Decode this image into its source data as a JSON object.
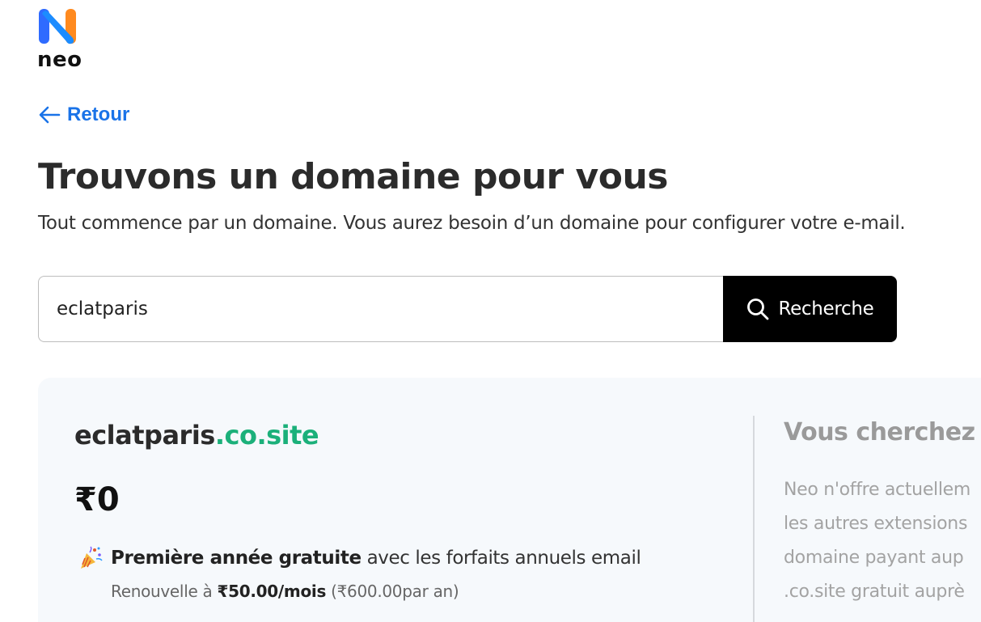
{
  "brand": {
    "name": "neo",
    "colors": {
      "blue": "#2f6bff",
      "orange": "#ff8a1f",
      "accent_link": "#1a73e8",
      "tld_green": "#1bb07a"
    }
  },
  "nav": {
    "back_label": "Retour",
    "back_icon": "arrow-left-icon"
  },
  "header": {
    "title": "Trouvons un domaine pour vous",
    "subtitle": "Tout commence par un domaine. Vous aurez besoin d’un domaine pour configurer votre e-mail."
  },
  "search": {
    "value": "eclatparis",
    "button_label": "Recherche",
    "button_icon": "search-icon"
  },
  "result": {
    "domain_base": "eclatparis",
    "domain_tld": ".co.site",
    "price": "₹0",
    "promo_icon": "party-popper-icon",
    "promo_strong": "Première année gratuite",
    "promo_rest": "avec les forfaits annuels email",
    "renew_prefix": "Renouvelle à",
    "renew_price": "₹50.00/mois",
    "renew_suffix": "(₹600.00par an)"
  },
  "side": {
    "title": "Vous cherchez u",
    "lines": [
      "Neo n'offre actuellem",
      "les autres extensions",
      "domaine payant aup",
      ".co.site gratuit auprè"
    ]
  }
}
